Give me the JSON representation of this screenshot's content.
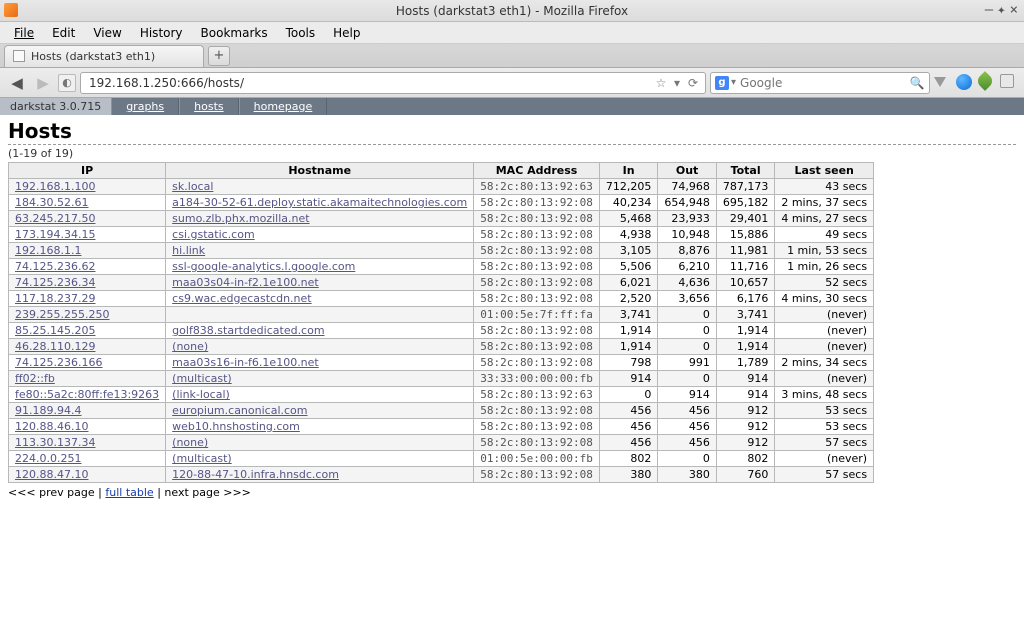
{
  "window": {
    "title": "Hosts (darkstat3 eth1) - Mozilla Firefox"
  },
  "menubar": {
    "file": "File",
    "edit": "Edit",
    "view": "View",
    "history": "History",
    "bookmarks": "Bookmarks",
    "tools": "Tools",
    "help": "Help"
  },
  "tab": {
    "label": "Hosts (darkstat3 eth1)"
  },
  "newtab": "+",
  "urlbar": {
    "value": "192.168.1.250:666/hosts/"
  },
  "search": {
    "placeholder": "Google",
    "g": "g"
  },
  "appnav": {
    "brand": "darkstat 3.0.715",
    "items": [
      {
        "label": "graphs"
      },
      {
        "label": "hosts"
      },
      {
        "label": "homepage"
      }
    ]
  },
  "page": {
    "title": "Hosts",
    "range": "(1-19 of 19)"
  },
  "columns": {
    "ip": "IP",
    "hostname": "Hostname",
    "mac": "MAC Address",
    "in": "In",
    "out": "Out",
    "total": "Total",
    "lastseen": "Last seen"
  },
  "rows": [
    {
      "ip": "192.168.1.100",
      "host": "sk.local",
      "mac": "58:2c:80:13:92:63",
      "in": "712,205",
      "out": "74,968",
      "total": "787,173",
      "last": "43 secs"
    },
    {
      "ip": "184.30.52.61",
      "host": "a184-30-52-61.deploy.static.akamaitechnologies.com",
      "mac": "58:2c:80:13:92:08",
      "in": "40,234",
      "out": "654,948",
      "total": "695,182",
      "last": "2 mins, 37 secs"
    },
    {
      "ip": "63.245.217.50",
      "host": "sumo.zlb.phx.mozilla.net",
      "mac": "58:2c:80:13:92:08",
      "in": "5,468",
      "out": "23,933",
      "total": "29,401",
      "last": "4 mins, 27 secs"
    },
    {
      "ip": "173.194.34.15",
      "host": "csi.gstatic.com",
      "mac": "58:2c:80:13:92:08",
      "in": "4,938",
      "out": "10,948",
      "total": "15,886",
      "last": "49 secs"
    },
    {
      "ip": "192.168.1.1",
      "host": "hi.link",
      "mac": "58:2c:80:13:92:08",
      "in": "3,105",
      "out": "8,876",
      "total": "11,981",
      "last": "1 min, 53 secs"
    },
    {
      "ip": "74.125.236.62",
      "host": "ssl-google-analytics.l.google.com",
      "mac": "58:2c:80:13:92:08",
      "in": "5,506",
      "out": "6,210",
      "total": "11,716",
      "last": "1 min, 26 secs"
    },
    {
      "ip": "74.125.236.34",
      "host": "maa03s04-in-f2.1e100.net",
      "mac": "58:2c:80:13:92:08",
      "in": "6,021",
      "out": "4,636",
      "total": "10,657",
      "last": "52 secs"
    },
    {
      "ip": "117.18.237.29",
      "host": "cs9.wac.edgecastcdn.net",
      "mac": "58:2c:80:13:92:08",
      "in": "2,520",
      "out": "3,656",
      "total": "6,176",
      "last": "4 mins, 30 secs"
    },
    {
      "ip": "239.255.255.250",
      "host": "",
      "mac": "01:00:5e:7f:ff:fa",
      "in": "3,741",
      "out": "0",
      "total": "3,741",
      "last": "(never)"
    },
    {
      "ip": "85.25.145.205",
      "host": "golf838.startdedicated.com",
      "mac": "58:2c:80:13:92:08",
      "in": "1,914",
      "out": "0",
      "total": "1,914",
      "last": "(never)"
    },
    {
      "ip": "46.28.110.129",
      "host": "(none)",
      "mac": "58:2c:80:13:92:08",
      "in": "1,914",
      "out": "0",
      "total": "1,914",
      "last": "(never)"
    },
    {
      "ip": "74.125.236.166",
      "host": "maa03s16-in-f6.1e100.net",
      "mac": "58:2c:80:13:92:08",
      "in": "798",
      "out": "991",
      "total": "1,789",
      "last": "2 mins, 34 secs"
    },
    {
      "ip": "ff02::fb",
      "host": "(multicast)",
      "mac": "33:33:00:00:00:fb",
      "in": "914",
      "out": "0",
      "total": "914",
      "last": "(never)"
    },
    {
      "ip": "fe80::5a2c:80ff:fe13:9263",
      "host": "(link-local)",
      "mac": "58:2c:80:13:92:63",
      "in": "0",
      "out": "914",
      "total": "914",
      "last": "3 mins, 48 secs"
    },
    {
      "ip": "91.189.94.4",
      "host": "europium.canonical.com",
      "mac": "58:2c:80:13:92:08",
      "in": "456",
      "out": "456",
      "total": "912",
      "last": "53 secs"
    },
    {
      "ip": "120.88.46.10",
      "host": "web10.hnshosting.com",
      "mac": "58:2c:80:13:92:08",
      "in": "456",
      "out": "456",
      "total": "912",
      "last": "53 secs"
    },
    {
      "ip": "113.30.137.34",
      "host": "(none)",
      "mac": "58:2c:80:13:92:08",
      "in": "456",
      "out": "456",
      "total": "912",
      "last": "57 secs"
    },
    {
      "ip": "224.0.0.251",
      "host": "(multicast)",
      "mac": "01:00:5e:00:00:fb",
      "in": "802",
      "out": "0",
      "total": "802",
      "last": "(never)"
    },
    {
      "ip": "120.88.47.10",
      "host": "120-88-47-10.infra.hnsdc.com",
      "mac": "58:2c:80:13:92:08",
      "in": "380",
      "out": "380",
      "total": "760",
      "last": "57 secs"
    }
  ],
  "pager": {
    "prev": "<<< prev page",
    "sep1": " | ",
    "full": "full table",
    "sep2": " | ",
    "next": "next page >>>"
  }
}
